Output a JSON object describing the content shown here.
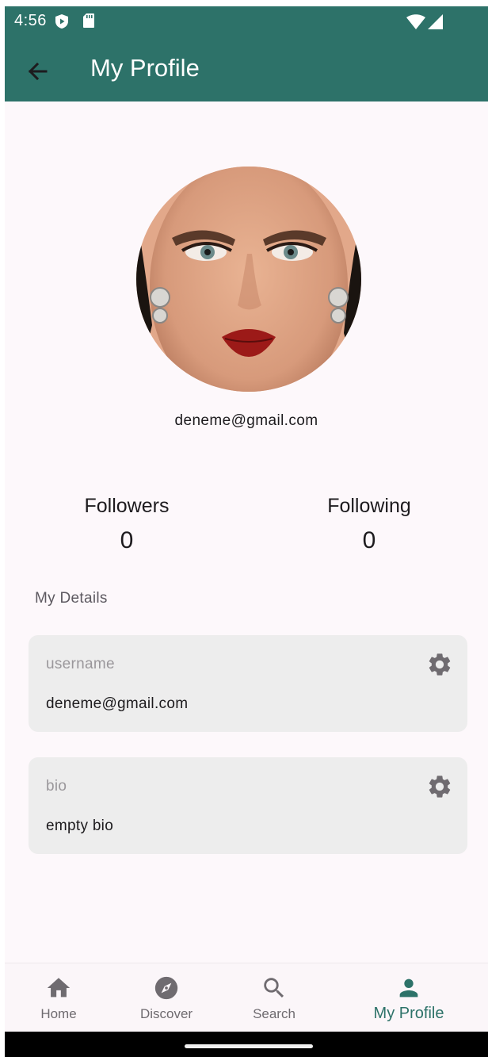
{
  "status_bar": {
    "time": "4:56"
  },
  "app_bar": {
    "title": "My Profile"
  },
  "profile": {
    "email": "deneme@gmail.com",
    "followers_label": "Followers",
    "followers_count": "0",
    "following_label": "Following",
    "following_count": "0"
  },
  "details": {
    "heading": "My Details",
    "items": [
      {
        "label": "username",
        "value": "deneme@gmail.com"
      },
      {
        "label": "bio",
        "value": "empty bio"
      }
    ]
  },
  "bottom_nav": {
    "items": [
      {
        "label": "Home",
        "icon": "home-icon"
      },
      {
        "label": "Discover",
        "icon": "compass-icon"
      },
      {
        "label": "Search",
        "icon": "search-icon"
      },
      {
        "label": "My Profile",
        "icon": "person-icon"
      }
    ],
    "active": "My Profile"
  },
  "colors": {
    "primary": "#2d7269",
    "background": "#fdf8fb",
    "card": "#ededed",
    "inactive": "#6f6b70"
  }
}
